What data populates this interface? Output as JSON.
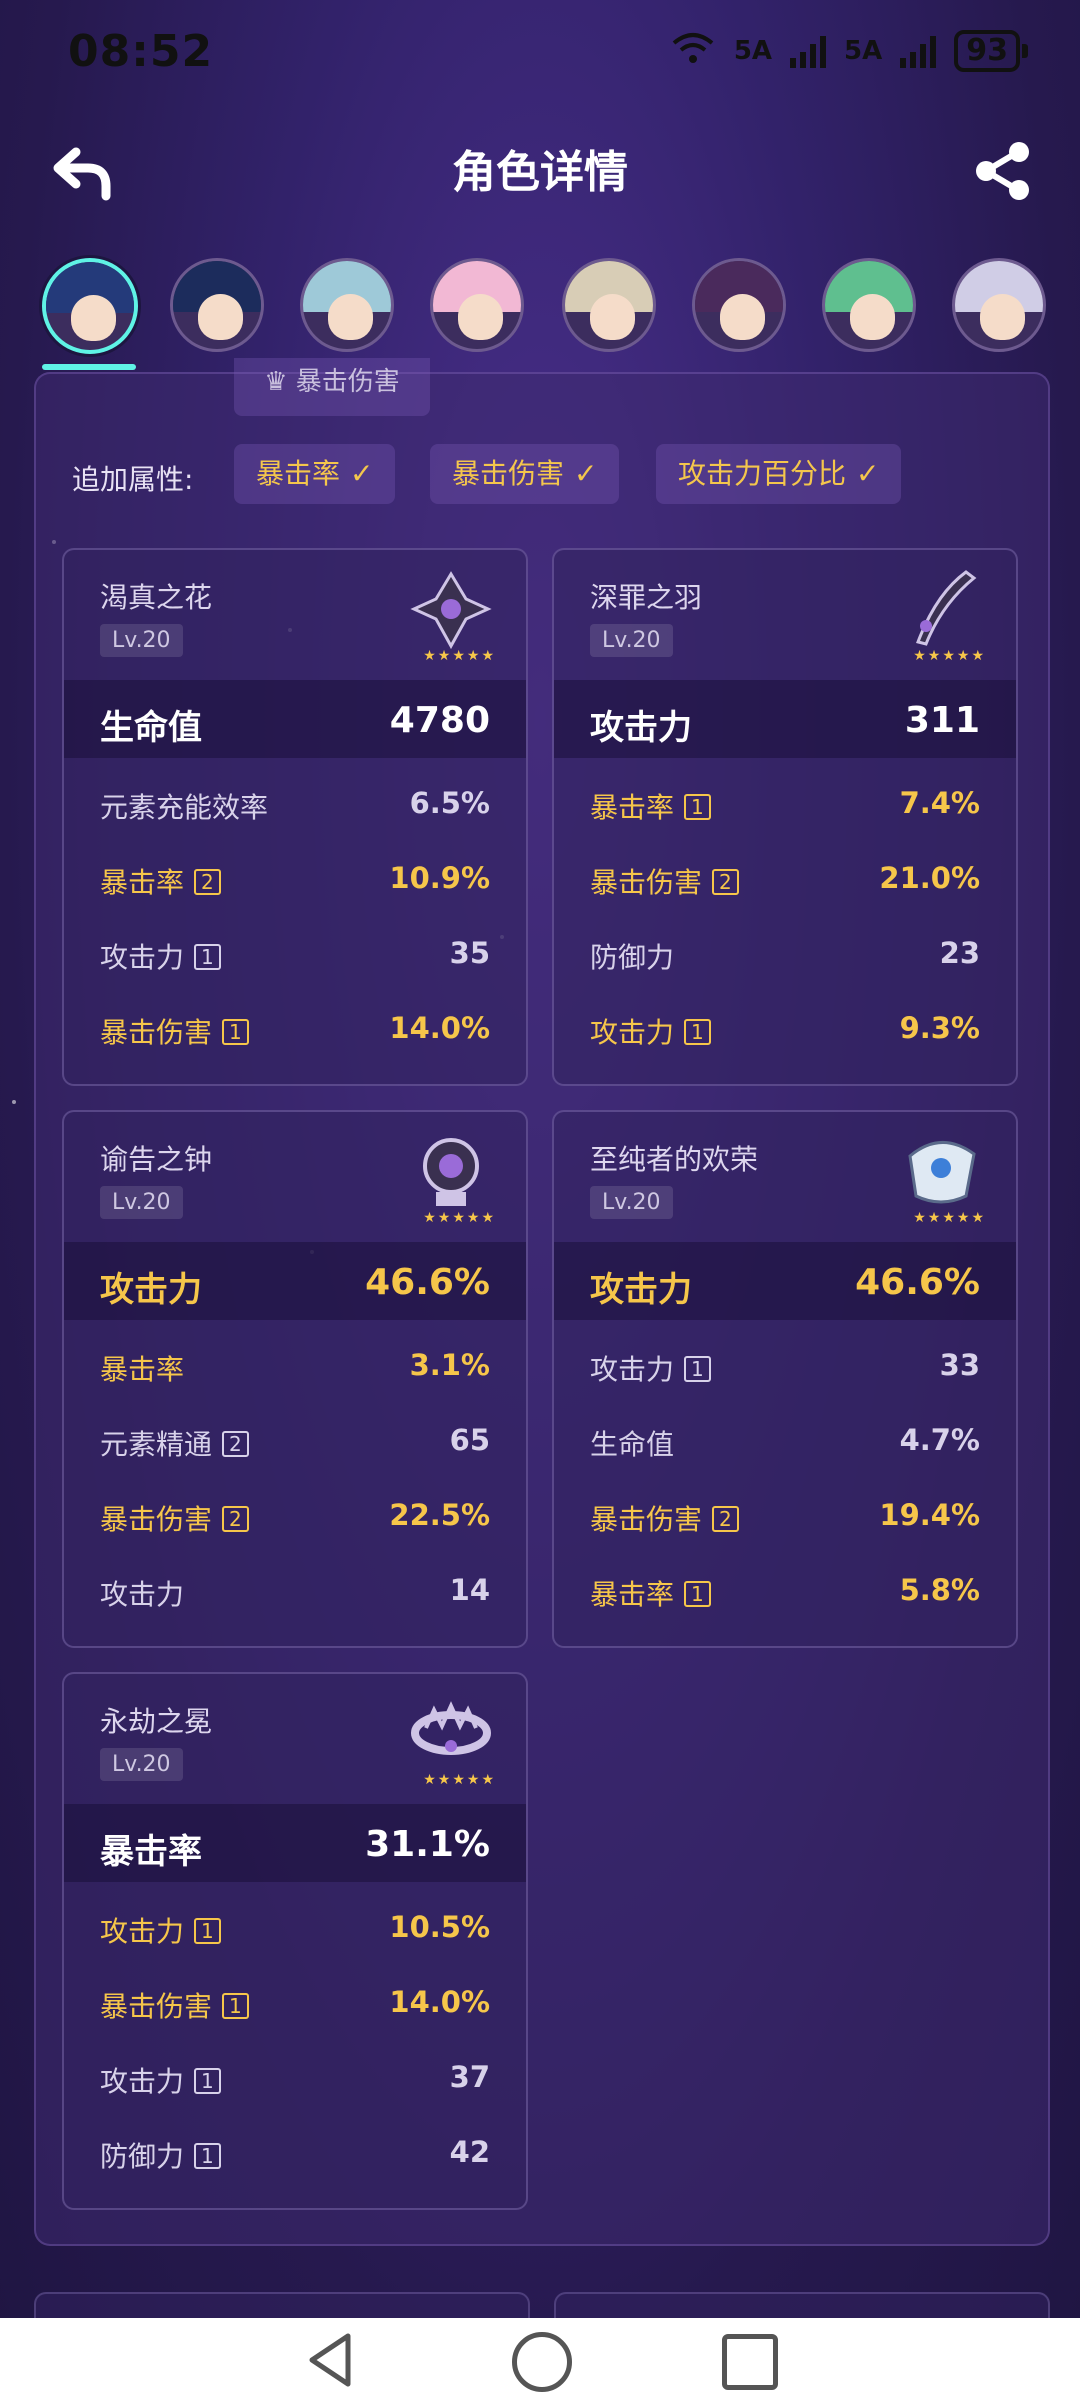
{
  "status_bar": {
    "time": "08:52",
    "network1": "6",
    "network2": "5A",
    "network3": "5A",
    "battery": "93"
  },
  "header": {
    "title": "角色详情"
  },
  "avatars": [
    {
      "name": "avatar-1",
      "selected": true,
      "hair": "#243a7a"
    },
    {
      "name": "avatar-2",
      "selected": false,
      "hair": "#1c2c5c"
    },
    {
      "name": "avatar-3",
      "selected": false,
      "hair": "#9ec9d8"
    },
    {
      "name": "avatar-4",
      "selected": false,
      "hair": "#f2b8d4"
    },
    {
      "name": "avatar-5",
      "selected": false,
      "hair": "#d8cdb6"
    },
    {
      "name": "avatar-6",
      "selected": false,
      "hair": "#4a2a5c"
    },
    {
      "name": "avatar-7",
      "selected": false,
      "hair": "#5fbf8f"
    },
    {
      "name": "avatar-8",
      "selected": false,
      "hair": "#d0cde6"
    }
  ],
  "prev_chip": "暴击伤害",
  "extra": {
    "label": "追加属性:",
    "chips": [
      "暴击率",
      "暴击伤害",
      "攻击力百分比"
    ]
  },
  "cards": [
    {
      "name": "渴真之花",
      "level": "Lv.20",
      "main": {
        "key": "生命值",
        "value": "4780",
        "gold": false
      },
      "subs": [
        {
          "key": "元素充能效率",
          "badge": "",
          "value": "6.5%",
          "gold": false
        },
        {
          "key": "暴击率",
          "badge": "2",
          "value": "10.9%",
          "gold": true
        },
        {
          "key": "攻击力",
          "badge": "1",
          "value": "35",
          "gold": false
        },
        {
          "key": "暴击伤害",
          "badge": "1",
          "value": "14.0%",
          "gold": true
        }
      ]
    },
    {
      "name": "深罪之羽",
      "level": "Lv.20",
      "main": {
        "key": "攻击力",
        "value": "311",
        "gold": false
      },
      "subs": [
        {
          "key": "暴击率",
          "badge": "1",
          "value": "7.4%",
          "gold": true
        },
        {
          "key": "暴击伤害",
          "badge": "2",
          "value": "21.0%",
          "gold": true
        },
        {
          "key": "防御力",
          "badge": "",
          "value": "23",
          "gold": false
        },
        {
          "key": "攻击力",
          "badge": "1",
          "value": "9.3%",
          "gold": true
        }
      ]
    },
    {
      "name": "谕告之钟",
      "level": "Lv.20",
      "main": {
        "key": "攻击力",
        "value": "46.6%",
        "gold": true
      },
      "subs": [
        {
          "key": "暴击率",
          "badge": "",
          "value": "3.1%",
          "gold": true
        },
        {
          "key": "元素精通",
          "badge": "2",
          "value": "65",
          "gold": false
        },
        {
          "key": "暴击伤害",
          "badge": "2",
          "value": "22.5%",
          "gold": true
        },
        {
          "key": "攻击力",
          "badge": "",
          "value": "14",
          "gold": false
        }
      ]
    },
    {
      "name": "至纯者的欢荣",
      "level": "Lv.20",
      "main": {
        "key": "攻击力",
        "value": "46.6%",
        "gold": true
      },
      "subs": [
        {
          "key": "攻击力",
          "badge": "1",
          "value": "33",
          "gold": false
        },
        {
          "key": "生命值",
          "badge": "",
          "value": "4.7%",
          "gold": false
        },
        {
          "key": "暴击伤害",
          "badge": "2",
          "value": "19.4%",
          "gold": true
        },
        {
          "key": "暴击率",
          "badge": "1",
          "value": "5.8%",
          "gold": true
        }
      ]
    },
    {
      "name": "永劫之冕",
      "level": "Lv.20",
      "main": {
        "key": "暴击率",
        "value": "31.1%",
        "gold": false
      },
      "subs": [
        {
          "key": "攻击力",
          "badge": "1",
          "value": "10.5%",
          "gold": true
        },
        {
          "key": "暴击伤害",
          "badge": "1",
          "value": "14.0%",
          "gold": true
        },
        {
          "key": "攻击力",
          "badge": "1",
          "value": "37",
          "gold": false
        },
        {
          "key": "防御力",
          "badge": "1",
          "value": "42",
          "gold": false
        }
      ]
    }
  ],
  "colors": {
    "accent": "#5ff3e6",
    "gold": "#f6c64a",
    "panel": "#3e2a70"
  }
}
